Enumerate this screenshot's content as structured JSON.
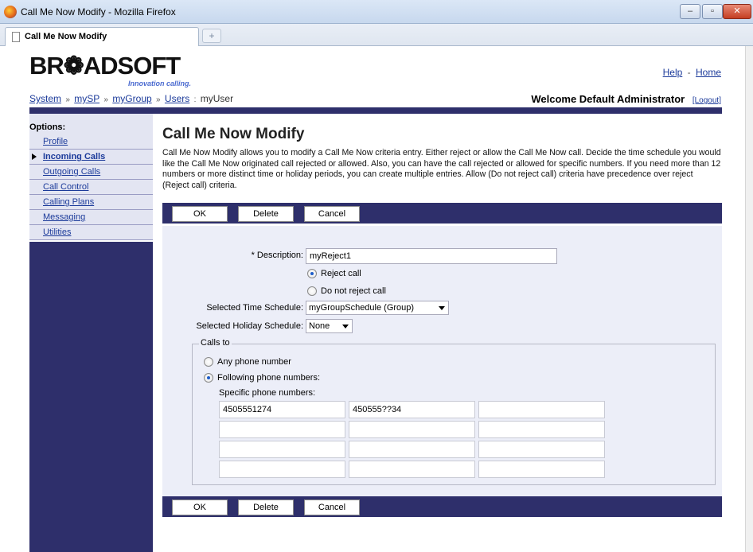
{
  "window": {
    "title": "Call Me Now Modify - Mozilla Firefox"
  },
  "tabs": [
    {
      "label": "Call Me Now Modify"
    }
  ],
  "header": {
    "brand": "BR❁ADSOFT",
    "tagline": "Innovation calling.",
    "help_label": "Help",
    "home_label": "Home",
    "link_sep": "-",
    "breadcrumb": [
      {
        "label": "System"
      },
      {
        "label": "mySP"
      },
      {
        "label": "myGroup"
      },
      {
        "label": "Users"
      },
      {
        "label": "myUser"
      }
    ],
    "breadcrumb_sep": "»",
    "breadcrumb_last_sep": ":",
    "welcome": "Welcome Default Administrator",
    "logout_label": "[Logout]"
  },
  "sidebar": {
    "title": "Options:",
    "items": [
      {
        "label": "Profile",
        "active": false
      },
      {
        "label": "Incoming Calls",
        "active": true
      },
      {
        "label": "Outgoing Calls",
        "active": false
      },
      {
        "label": "Call Control",
        "active": false
      },
      {
        "label": "Calling Plans",
        "active": false
      },
      {
        "label": "Messaging",
        "active": false
      },
      {
        "label": "Utilities",
        "active": false
      }
    ]
  },
  "main": {
    "title": "Call Me Now Modify",
    "description": "Call Me Now Modify allows you to modify a Call Me Now criteria entry. Either reject or allow the Call Me Now call. Decide the time schedule you would like the Call Me Now originated call rejected or allowed. Also, you can have the call rejected or allowed for specific numbers. If you need more than 12 numbers or more distinct time or holiday periods, you can create multiple entries. Allow (Do not reject call) criteria have precedence over reject (Reject call) criteria."
  },
  "buttons": {
    "ok": "OK",
    "delete": "Delete",
    "cancel": "Cancel"
  },
  "form": {
    "description_label": "* Description:",
    "description_value": "myReject1",
    "reject_options": [
      {
        "label": "Reject call",
        "selected": true
      },
      {
        "label": "Do not reject call",
        "selected": false
      }
    ],
    "time_schedule_label": "Selected Time Schedule:",
    "time_schedule_value": "myGroupSchedule (Group)",
    "holiday_schedule_label": "Selected Holiday Schedule:",
    "holiday_schedule_value": "None",
    "calls_to": {
      "legend": "Calls to",
      "options": [
        {
          "label": "Any phone number",
          "selected": false
        },
        {
          "label": "Following phone numbers:",
          "selected": true
        }
      ],
      "specific_label": "Specific phone numbers:",
      "phone_numbers": [
        [
          "4505551274",
          "450555??34",
          ""
        ],
        [
          "",
          "",
          ""
        ],
        [
          "",
          "",
          ""
        ],
        [
          "",
          "",
          ""
        ]
      ]
    }
  },
  "colors": {
    "nav_dark": "#2e2f6b",
    "link": "#1b3a9a",
    "form_bg": "#eceef8"
  }
}
